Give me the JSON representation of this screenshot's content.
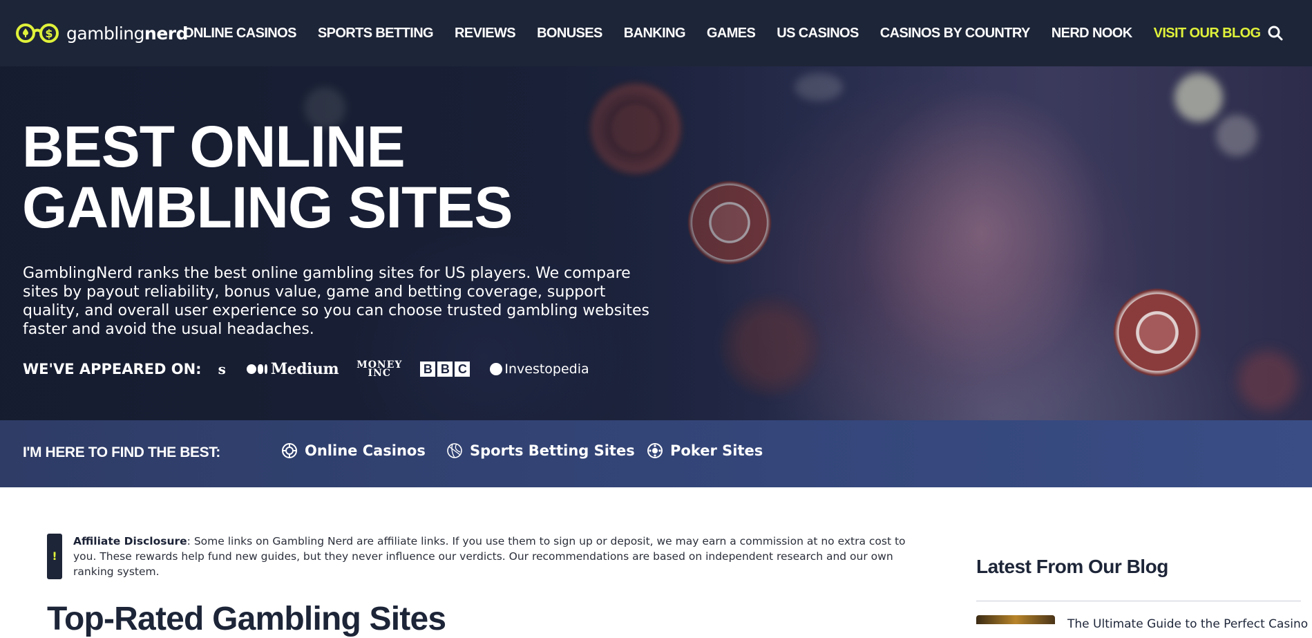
{
  "brand": {
    "logo_light": "gambling",
    "logo_bold": "nerd",
    "accent_color": "#e0f23a",
    "nav_bg": "#1d2538"
  },
  "nav": {
    "items": [
      {
        "label": "ONLINE CASINOS"
      },
      {
        "label": "SPORTS BETTING"
      },
      {
        "label": "REVIEWS"
      },
      {
        "label": "BONUSES"
      },
      {
        "label": "BANKING"
      },
      {
        "label": "GAMES"
      },
      {
        "label": "US CASINOS"
      },
      {
        "label": "CASINOS BY COUNTRY"
      },
      {
        "label": "NERD NOOK"
      }
    ],
    "blog_link": "VISIT OUR BLOG",
    "search_icon": "search-icon"
  },
  "hero": {
    "title_line1": "BEST ONLINE",
    "title_line2": "GAMBLING SITES",
    "description": "GamblingNerd ranks the best online gambling sites for US players. We compare sites by payout reliability, bonus value, game and betting coverage, support quality, and overall user experience so you can choose trusted gambling websites faster and avoid the usual headaches.",
    "appeared_label": "WE'VE APPEARED ON:",
    "press": {
      "s": "s",
      "medium": "Medium",
      "money_line1": "MONEY",
      "money_line2": "INC",
      "bbc": [
        "B",
        "B",
        "C"
      ],
      "investopedia": "Investopedia"
    }
  },
  "find": {
    "label": "I'M HERE TO FIND THE BEST:",
    "links": [
      {
        "label": "Online Casinos",
        "icon": "casino-chip-icon"
      },
      {
        "label": "Sports Betting Sites",
        "icon": "basketball-icon"
      },
      {
        "label": "Poker Sites",
        "icon": "poker-chip-icon"
      }
    ]
  },
  "disclosure": {
    "icon": "!",
    "title": "Affiliate Disclosure",
    "text": ": Some links on Gambling Nerd are affiliate links. If you use them to sign up or deposit, we may earn a commission at no extra cost to you. These rewards help fund new guides, but they never influence our verdicts. Our recommendations are based on independent research and our own ranking system."
  },
  "main": {
    "section_title": "Top-Rated Gambling Sites"
  },
  "sidebar": {
    "blog_title": "Latest From Our Blog",
    "first_post_partial": "The Ultimate Guide to the Perfect Casino Night"
  }
}
